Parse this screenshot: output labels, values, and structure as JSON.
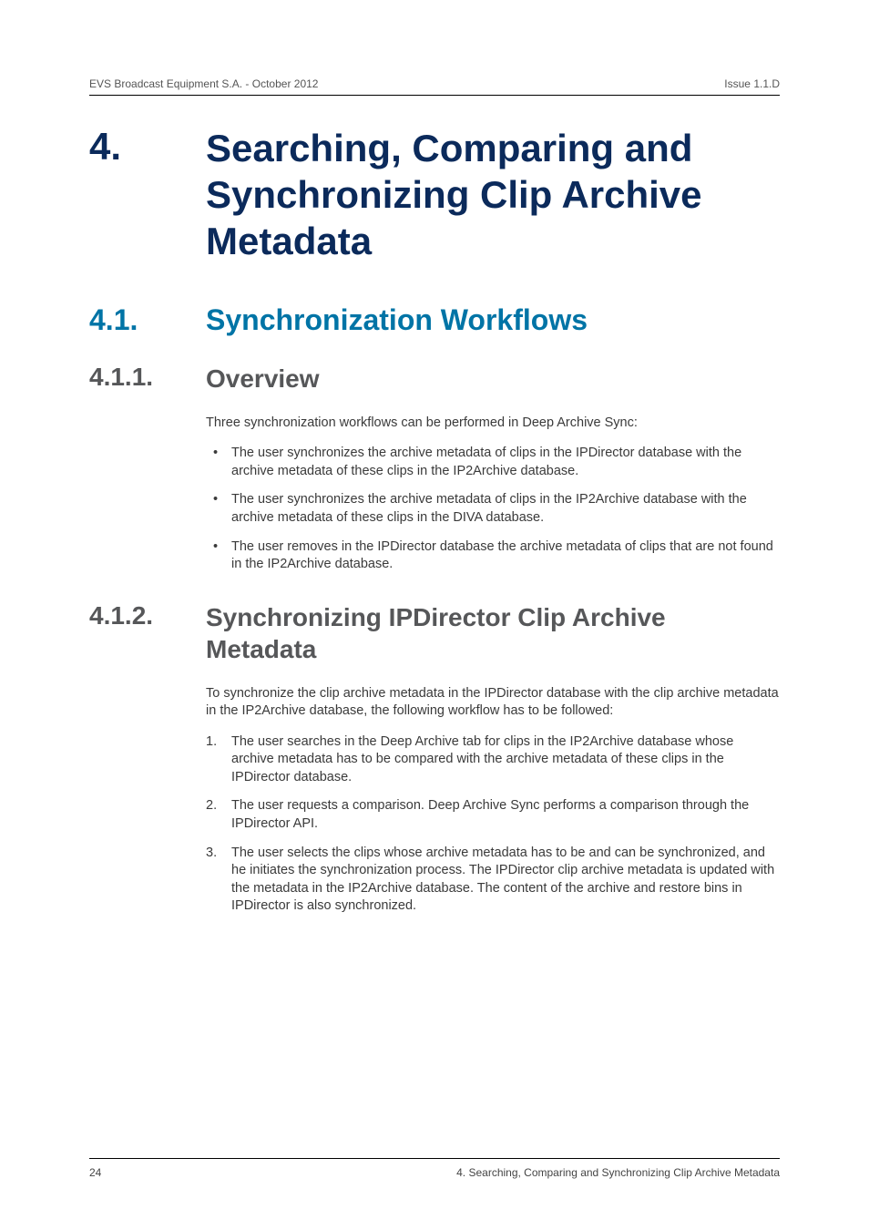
{
  "header": {
    "left": "EVS Broadcast Equipment S.A.  - October 2012",
    "right": "Issue 1.1.D"
  },
  "chapter": {
    "number": "4.",
    "title": "Searching, Comparing and Synchronizing Clip Archive Metadata"
  },
  "section": {
    "number": "4.1.",
    "title": "Synchronization Workflows"
  },
  "subsection1": {
    "number": "4.1.1.",
    "title": "Overview",
    "intro": "Three synchronization workflows can be performed in Deep Archive Sync:",
    "bullets": [
      "The user synchronizes the archive metadata of clips in the IPDirector database with the archive metadata of these clips in the IP2Archive database.",
      "The user synchronizes the archive metadata of clips in the IP2Archive database with the archive metadata of these clips in the DIVA database.",
      "The user removes in the IPDirector database the archive metadata of clips that are not found in the IP2Archive database."
    ]
  },
  "subsection2": {
    "number": "4.1.2.",
    "title": "Synchronizing IPDirector Clip Archive Metadata",
    "intro": "To synchronize the clip archive metadata in the IPDirector database with the clip archive metadata in the IP2Archive database, the following workflow has to be followed:",
    "steps": [
      "The user searches in the Deep Archive tab for clips in the IP2Archive database whose archive metadata has to be compared with the archive metadata of these clips in the IPDirector database.",
      "The user requests a comparison. Deep Archive Sync performs a comparison through the IPDirector API.",
      "The user selects the clips whose archive metadata has to be and can be synchronized, and he initiates the synchronization process. The IPDirector clip archive metadata is updated with the metadata in the IP2Archive database. The content of the archive and restore bins in IPDirector is also synchronized."
    ]
  },
  "footer": {
    "left": "24",
    "right": "4. Searching, Comparing and Synchronizing Clip Archive Metadata"
  }
}
